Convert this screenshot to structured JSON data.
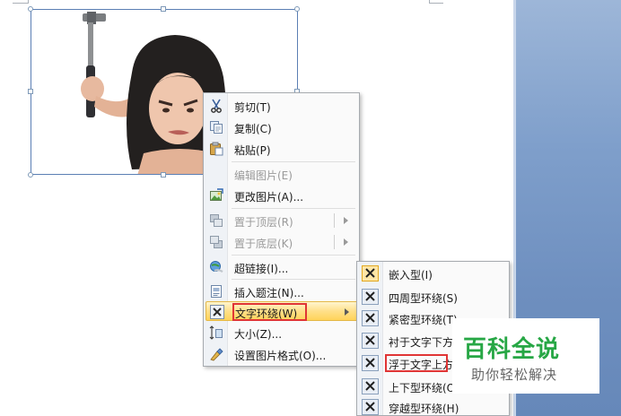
{
  "context_menu": {
    "items": [
      {
        "label": "剪切(T)",
        "icon": "scissors-icon",
        "disabled": false
      },
      {
        "label": "复制(C)",
        "icon": "copy-icon",
        "disabled": false
      },
      {
        "label": "粘贴(P)",
        "icon": "paste-icon",
        "disabled": false
      },
      {
        "label": "编辑图片(E)",
        "icon": "",
        "disabled": true
      },
      {
        "label": "更改图片(A)...",
        "icon": "change-picture-icon",
        "disabled": false
      },
      {
        "label": "置于顶层(R)",
        "icon": "bring-to-front-icon",
        "disabled": true,
        "submenu": true
      },
      {
        "label": "置于底层(K)",
        "icon": "send-to-back-icon",
        "disabled": true,
        "submenu": true
      },
      {
        "label": "超链接(I)...",
        "icon": "hyperlink-icon",
        "disabled": false
      },
      {
        "label": "插入题注(N)...",
        "icon": "insert-caption-icon",
        "disabled": false
      },
      {
        "label": "文字环绕(W)",
        "icon": "text-wrap-icon",
        "disabled": false,
        "submenu": true,
        "highlighted": true
      },
      {
        "label": "大小(Z)...",
        "icon": "size-icon",
        "disabled": false
      },
      {
        "label": "设置图片格式(O)...",
        "icon": "format-picture-icon",
        "disabled": false
      }
    ]
  },
  "wrap_submenu": {
    "items": [
      {
        "label": "嵌入型(I)",
        "selected": true
      },
      {
        "label": "四周型环绕(S)"
      },
      {
        "label": "紧密型环绕(T)"
      },
      {
        "label": "衬于文字下方(D)"
      },
      {
        "label": "浮于文字上方(N)",
        "boxed": true
      },
      {
        "label": "上下型环绕(O)"
      },
      {
        "label": "穿越型环绕(H)"
      }
    ]
  },
  "watermark": {
    "title": "百科全说",
    "subtitle": "助你轻松解决"
  },
  "colors": {
    "highlight_box": "#e03535",
    "watermark_green": "#27a745",
    "menu_hover": "#ffe08a",
    "side_blue": "#7f9fcb"
  }
}
